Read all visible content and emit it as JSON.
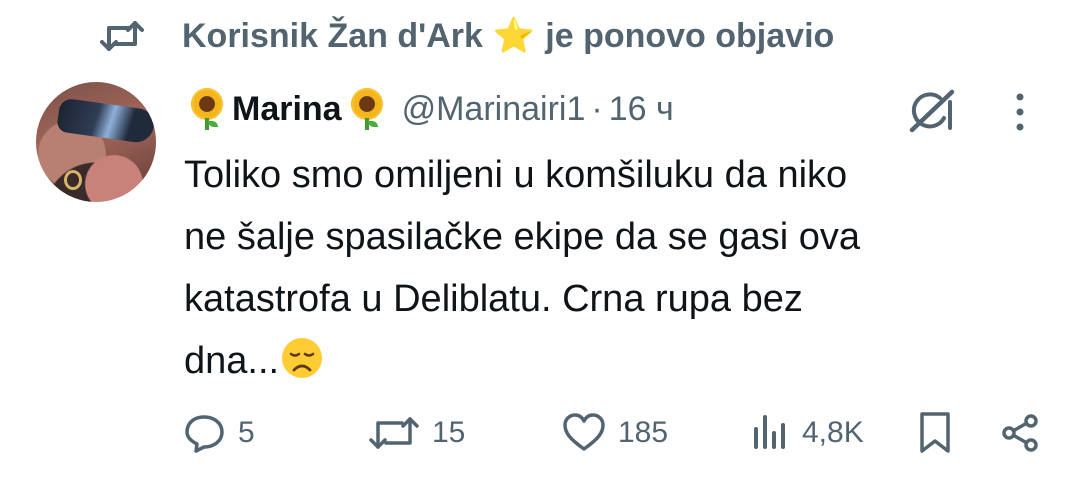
{
  "repost": {
    "prefix": "Korisnik Žan d'Ark",
    "star": "⭐",
    "suffix": "je ponovo objavio",
    "icon": "repost-icon"
  },
  "tweet": {
    "display_name": "Marina",
    "name_emoji": "sunflower",
    "handle": "@Marinairi1",
    "separator": "·",
    "time": "16 ч",
    "text_lines": [
      "Toliko smo omiljeni u komšiluku da niko",
      "ne šalje spasilačke ekipe da se gasi ova",
      "katastrofa u Deliblatu. Crna rupa bez",
      "dna..."
    ],
    "trailing_emoji": "disappointed-face"
  },
  "actions": {
    "replies": "5",
    "reposts": "15",
    "likes": "185",
    "views": "4,8K"
  },
  "colors": {
    "text": "#0f1419",
    "muted": "#536471",
    "star": "#f5b301"
  }
}
